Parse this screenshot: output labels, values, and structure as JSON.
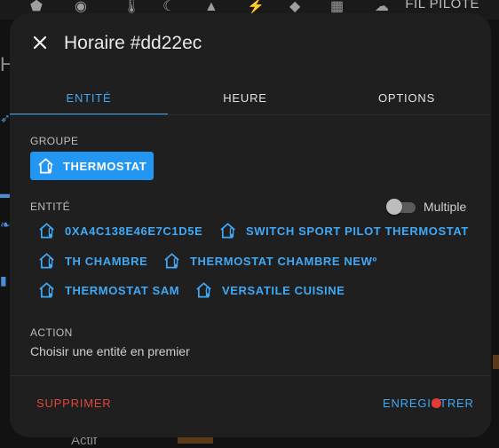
{
  "background": {
    "top_title": "FIL PILOTE",
    "left_letter": "H",
    "bottom_text": "Actif"
  },
  "dialog": {
    "title": "Horaire #dd22ec",
    "tabs": [
      {
        "label": "ENTITÉ",
        "active": true
      },
      {
        "label": "HEURE",
        "active": false
      },
      {
        "label": "OPTIONS",
        "active": false
      }
    ],
    "groupe": {
      "label": "GROUPE",
      "selected": "THERMOSTAT"
    },
    "entite": {
      "label": "ENTITÉ",
      "multiple_label": "Multiple",
      "multiple_on": false,
      "items": [
        "0XA4C138E46E7C1D5E",
        "SWITCH SPORT PILOT THERMOSTAT",
        "TH CHAMBRE",
        "THERMOSTAT CHAMBRE NEWº",
        "THERMOSTAT SAM",
        "VERSATILE CUISINE"
      ]
    },
    "action": {
      "label": "ACTION",
      "value": "Choisir une entité en premier"
    },
    "footer": {
      "delete_label": "SUPPRIMER",
      "save_label": "ENREGISTRER"
    }
  },
  "colors": {
    "accent": "#3fa9f5",
    "chip": "#2196f3",
    "danger": "#e0473c",
    "surface": "#1f1f1f"
  }
}
